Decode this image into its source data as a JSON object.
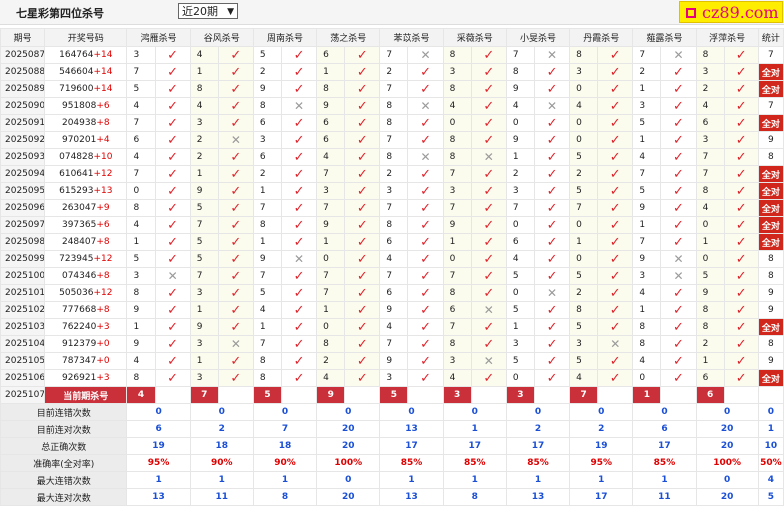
{
  "header": {
    "title": "七星彩第四位杀号",
    "select_value": "近20期"
  },
  "logo": {
    "text": "cz89.com"
  },
  "columns": {
    "issue": "期号",
    "draw": "开奖号码",
    "experts": [
      "鸿雁杀号",
      "谷风杀号",
      "周南杀号",
      "荡之杀号",
      "苯苡杀号",
      "采薇杀号",
      "小旻杀号",
      "丹霞杀号",
      "薤露杀号",
      "浮萍杀号"
    ],
    "stat": "统计"
  },
  "rows": [
    {
      "issue": "2025087",
      "nums": "164764",
      "key": "+14",
      "picks": [
        3,
        4,
        5,
        6,
        7,
        8,
        7,
        8,
        7,
        8
      ],
      "res": [
        1,
        1,
        1,
        1,
        0,
        1,
        0,
        1,
        0,
        1
      ],
      "stat": "7"
    },
    {
      "issue": "2025088",
      "nums": "546604",
      "key": "+14",
      "picks": [
        7,
        1,
        2,
        1,
        2,
        3,
        8,
        3,
        2,
        3
      ],
      "res": [
        1,
        1,
        1,
        1,
        1,
        1,
        1,
        1,
        1,
        1
      ],
      "stat": "全对"
    },
    {
      "issue": "2025089",
      "nums": "719600",
      "key": "+14",
      "picks": [
        5,
        8,
        9,
        8,
        7,
        8,
        9,
        0,
        1,
        2
      ],
      "res": [
        1,
        1,
        1,
        1,
        1,
        1,
        1,
        1,
        1,
        1
      ],
      "stat": "全对"
    },
    {
      "issue": "2025090",
      "nums": "951808",
      "key": "+6",
      "picks": [
        4,
        4,
        8,
        9,
        8,
        4,
        4,
        4,
        3,
        4
      ],
      "res": [
        1,
        1,
        0,
        1,
        0,
        1,
        0,
        1,
        1,
        1
      ],
      "stat": "7"
    },
    {
      "issue": "2025091",
      "nums": "204938",
      "key": "+8",
      "picks": [
        7,
        3,
        6,
        6,
        8,
        0,
        0,
        0,
        5,
        6
      ],
      "res": [
        1,
        1,
        1,
        1,
        1,
        1,
        1,
        1,
        1,
        1
      ],
      "stat": "全对"
    },
    {
      "issue": "2025092",
      "nums": "970201",
      "key": "+4",
      "picks": [
        6,
        2,
        3,
        6,
        7,
        8,
        9,
        0,
        1,
        3
      ],
      "res": [
        1,
        0,
        1,
        1,
        1,
        1,
        1,
        1,
        1,
        1
      ],
      "stat": "9"
    },
    {
      "issue": "2025093",
      "nums": "074828",
      "key": "+10",
      "picks": [
        4,
        2,
        6,
        4,
        8,
        8,
        1,
        5,
        4,
        7
      ],
      "res": [
        1,
        1,
        1,
        1,
        0,
        0,
        1,
        1,
        1,
        1
      ],
      "stat": "8"
    },
    {
      "issue": "2025094",
      "nums": "610641",
      "key": "+12",
      "picks": [
        7,
        1,
        2,
        7,
        2,
        7,
        2,
        2,
        7,
        7
      ],
      "res": [
        1,
        1,
        1,
        1,
        1,
        1,
        1,
        1,
        1,
        1
      ],
      "stat": "全对"
    },
    {
      "issue": "2025095",
      "nums": "615293",
      "key": "+13",
      "picks": [
        0,
        9,
        1,
        3,
        3,
        3,
        3,
        5,
        5,
        8
      ],
      "res": [
        1,
        1,
        1,
        1,
        1,
        1,
        1,
        1,
        1,
        1
      ],
      "stat": "全对"
    },
    {
      "issue": "2025096",
      "nums": "263047",
      "key": "+9",
      "picks": [
        8,
        5,
        7,
        7,
        7,
        7,
        7,
        7,
        9,
        4
      ],
      "res": [
        1,
        1,
        1,
        1,
        1,
        1,
        1,
        1,
        1,
        1
      ],
      "stat": "全对"
    },
    {
      "issue": "2025097",
      "nums": "397365",
      "key": "+6",
      "picks": [
        4,
        7,
        8,
        9,
        8,
        9,
        0,
        0,
        1,
        0
      ],
      "res": [
        1,
        1,
        1,
        1,
        1,
        1,
        1,
        1,
        1,
        1
      ],
      "stat": "全对"
    },
    {
      "issue": "2025098",
      "nums": "248407",
      "key": "+8",
      "picks": [
        1,
        5,
        1,
        1,
        6,
        1,
        6,
        1,
        7,
        1
      ],
      "res": [
        1,
        1,
        1,
        1,
        1,
        1,
        1,
        1,
        1,
        1
      ],
      "stat": "全对"
    },
    {
      "issue": "2025099",
      "nums": "723945",
      "key": "+12",
      "picks": [
        5,
        5,
        9,
        0,
        4,
        0,
        4,
        0,
        9,
        0
      ],
      "res": [
        1,
        1,
        0,
        1,
        1,
        1,
        1,
        1,
        0,
        1
      ],
      "stat": "8"
    },
    {
      "issue": "2025100",
      "nums": "074346",
      "key": "+8",
      "picks": [
        3,
        7,
        7,
        7,
        7,
        7,
        5,
        5,
        3,
        5
      ],
      "res": [
        0,
        1,
        1,
        1,
        1,
        1,
        1,
        1,
        0,
        1
      ],
      "stat": "8"
    },
    {
      "issue": "2025101",
      "nums": "505036",
      "key": "+12",
      "picks": [
        8,
        3,
        5,
        7,
        6,
        8,
        0,
        2,
        4,
        9
      ],
      "res": [
        1,
        1,
        1,
        1,
        1,
        1,
        0,
        1,
        1,
        1
      ],
      "stat": "9"
    },
    {
      "issue": "2025102",
      "nums": "777668",
      "key": "+8",
      "picks": [
        9,
        1,
        4,
        1,
        9,
        6,
        5,
        8,
        1,
        8
      ],
      "res": [
        1,
        1,
        1,
        1,
        1,
        0,
        1,
        1,
        1,
        1
      ],
      "stat": "9"
    },
    {
      "issue": "2025103",
      "nums": "762240",
      "key": "+3",
      "picks": [
        1,
        9,
        1,
        0,
        4,
        7,
        1,
        5,
        8,
        8
      ],
      "res": [
        1,
        1,
        1,
        1,
        1,
        1,
        1,
        1,
        1,
        1
      ],
      "stat": "全对"
    },
    {
      "issue": "2025104",
      "nums": "912379",
      "key": "+0",
      "picks": [
        9,
        3,
        7,
        8,
        7,
        8,
        3,
        3,
        8,
        2
      ],
      "res": [
        1,
        0,
        1,
        1,
        1,
        1,
        1,
        0,
        1,
        1
      ],
      "stat": "8"
    },
    {
      "issue": "2025105",
      "nums": "787347",
      "key": "+0",
      "picks": [
        4,
        1,
        8,
        2,
        9,
        3,
        5,
        5,
        4,
        1
      ],
      "res": [
        1,
        1,
        1,
        1,
        1,
        0,
        1,
        1,
        1,
        1
      ],
      "stat": "9"
    },
    {
      "issue": "2025106",
      "nums": "926921",
      "key": "+3",
      "picks": [
        8,
        3,
        8,
        4,
        3,
        4,
        0,
        4,
        0,
        6
      ],
      "res": [
        1,
        1,
        1,
        1,
        1,
        1,
        1,
        1,
        1,
        1
      ],
      "stat": "全对"
    }
  ],
  "current": {
    "issue": "2025107",
    "label": "当前期杀号",
    "picks": [
      "4",
      "7",
      "5",
      "9",
      "5",
      "3",
      "3",
      "7",
      "1",
      "6"
    ]
  },
  "summary": [
    {
      "label": "目前连错次数",
      "vals": [
        "0",
        "0",
        "0",
        "0",
        "0",
        "0",
        "0",
        "0",
        "0",
        "0"
      ],
      "total": "0"
    },
    {
      "label": "目前连对次数",
      "vals": [
        "6",
        "2",
        "7",
        "20",
        "13",
        "1",
        "2",
        "2",
        "6",
        "20"
      ],
      "total": "1"
    },
    {
      "label": "总正确次数",
      "vals": [
        "19",
        "18",
        "18",
        "20",
        "17",
        "17",
        "17",
        "19",
        "17",
        "20"
      ],
      "total": "10"
    },
    {
      "label": "准确率(全对率)",
      "vals": [
        "95%",
        "90%",
        "90%",
        "100%",
        "85%",
        "85%",
        "85%",
        "95%",
        "85%",
        "100%"
      ],
      "total": "50%"
    },
    {
      "label": "最大连错次数",
      "vals": [
        "1",
        "1",
        "1",
        "0",
        "1",
        "1",
        "1",
        "1",
        "1",
        "0"
      ],
      "total": "4"
    },
    {
      "label": "最大连对次数",
      "vals": [
        "13",
        "11",
        "8",
        "20",
        "13",
        "8",
        "13",
        "17",
        "11",
        "20"
      ],
      "total": "5"
    }
  ],
  "icons": {
    "right": "check-icon",
    "wrong": "cross-icon"
  },
  "colors": {
    "accent_red": "#e0242c",
    "all_right_bg": "#d0261b",
    "current_bg": "#c9303a",
    "stat_blue": "#1a4fd6"
  }
}
